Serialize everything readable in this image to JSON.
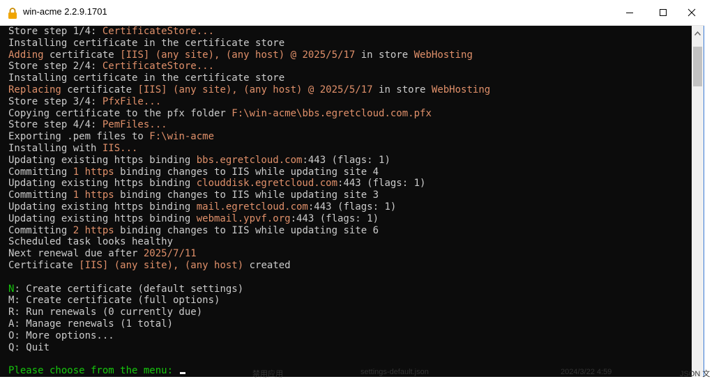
{
  "window": {
    "title": "win-acme 2.2.9.1701"
  },
  "console": {
    "lines": [
      [
        {
          "t": "Store step 1/4: "
        },
        {
          "t": "CertificateStore...",
          "c": "hl"
        }
      ],
      [
        {
          "t": "Installing certificate in the certificate store"
        }
      ],
      [
        {
          "t": "Adding",
          "c": "hl"
        },
        {
          "t": " certificate "
        },
        {
          "t": "[IIS] (any site), (any host) @ 2025/5/17",
          "c": "hl"
        },
        {
          "t": " in store "
        },
        {
          "t": "WebHosting",
          "c": "hl"
        }
      ],
      [
        {
          "t": "Store step 2/4: "
        },
        {
          "t": "CertificateStore...",
          "c": "hl"
        }
      ],
      [
        {
          "t": "Installing certificate in the certificate store"
        }
      ],
      [
        {
          "t": "Replacing",
          "c": "hl"
        },
        {
          "t": " certificate "
        },
        {
          "t": "[IIS] (any site), (any host) @ 2025/5/17",
          "c": "hl"
        },
        {
          "t": " in store "
        },
        {
          "t": "WebHosting",
          "c": "hl"
        }
      ],
      [
        {
          "t": "Store step 3/4: "
        },
        {
          "t": "PfxFile...",
          "c": "hl"
        }
      ],
      [
        {
          "t": "Copying certificate to the pfx folder "
        },
        {
          "t": "F:\\win-acme\\bbs.egretcloud.com.pfx",
          "c": "hl"
        }
      ],
      [
        {
          "t": "Store step 4/4: "
        },
        {
          "t": "PemFiles...",
          "c": "hl"
        }
      ],
      [
        {
          "t": "Exporting .pem files to "
        },
        {
          "t": "F:\\win-acme",
          "c": "hl"
        }
      ],
      [
        {
          "t": "Installing with "
        },
        {
          "t": "IIS...",
          "c": "hl"
        }
      ],
      [
        {
          "t": "Updating existing https binding "
        },
        {
          "t": "bbs.egretcloud.com",
          "c": "hl"
        },
        {
          "t": ":443 (flags: 1)"
        }
      ],
      [
        {
          "t": "Committing "
        },
        {
          "t": "1",
          "c": "hl"
        },
        {
          "t": " "
        },
        {
          "t": "https",
          "c": "hl"
        },
        {
          "t": " binding changes to IIS while updating site 4"
        }
      ],
      [
        {
          "t": "Updating existing https binding "
        },
        {
          "t": "clouddisk.egretcloud.com",
          "c": "hl"
        },
        {
          "t": ":443 (flags: 1)"
        }
      ],
      [
        {
          "t": "Committing "
        },
        {
          "t": "1",
          "c": "hl"
        },
        {
          "t": " "
        },
        {
          "t": "https",
          "c": "hl"
        },
        {
          "t": " binding changes to IIS while updating site 3"
        }
      ],
      [
        {
          "t": "Updating existing https binding "
        },
        {
          "t": "mail.egretcloud.com",
          "c": "hl"
        },
        {
          "t": ":443 (flags: 1)"
        }
      ],
      [
        {
          "t": "Updating existing https binding "
        },
        {
          "t": "webmail.ypvf.org",
          "c": "hl"
        },
        {
          "t": ":443 (flags: 1)"
        }
      ],
      [
        {
          "t": "Committing "
        },
        {
          "t": "2",
          "c": "hl"
        },
        {
          "t": " "
        },
        {
          "t": "https",
          "c": "hl"
        },
        {
          "t": " binding changes to IIS while updating site 6"
        }
      ],
      [
        {
          "t": "Scheduled task looks healthy"
        }
      ],
      [
        {
          "t": "Next renewal due after "
        },
        {
          "t": "2025/7/11",
          "c": "hl"
        }
      ],
      [
        {
          "t": "Certificate "
        },
        {
          "t": "[IIS] (any site), (any host)",
          "c": "hl"
        },
        {
          "t": " created"
        }
      ],
      [
        {
          "t": ""
        }
      ],
      [
        {
          "t": "N",
          "c": "green"
        },
        {
          "t": ": Create certificate (default settings)"
        }
      ],
      [
        {
          "t": "M: Create certificate (full options)"
        }
      ],
      [
        {
          "t": "R: Run renewals (0 currently due)"
        }
      ],
      [
        {
          "t": "A: Manage renewals (1 total)"
        }
      ],
      [
        {
          "t": "O: More options..."
        }
      ],
      [
        {
          "t": "Q: Quit"
        }
      ],
      [
        {
          "t": ""
        }
      ],
      [
        {
          "t": "Please choose from the menu: ",
          "c": "green"
        }
      ]
    ]
  },
  "background_window": {
    "fragments": [
      "禁用应用",
      "settings-default.json",
      "2024/3/22 4:59",
      "JSON 文"
    ]
  },
  "colors": {
    "console_bg": "#0c0c0c",
    "console_text": "#cccccc",
    "highlight": "#e0906a",
    "prompt_green": "#16c60c",
    "lock_icon": "#f0a500"
  },
  "icons": {
    "app": "lock-icon",
    "minimize": "minimize-icon",
    "maximize": "maximize-icon",
    "close": "close-icon",
    "scroll_up": "chevron-up-icon"
  }
}
